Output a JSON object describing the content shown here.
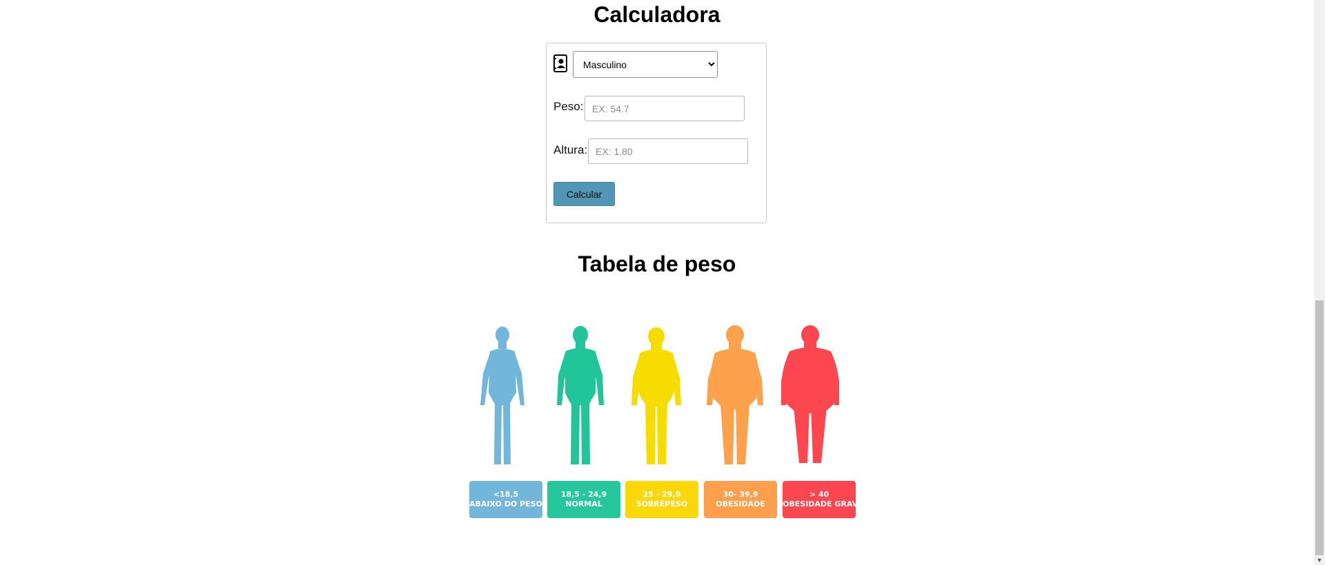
{
  "calculator": {
    "title": "Calculadora",
    "gender": {
      "selected": "Masculino",
      "options": [
        "Masculino"
      ]
    },
    "peso": {
      "label": "Peso:",
      "placeholder": "EX: 54.7",
      "value": ""
    },
    "altura": {
      "label": "Altura:",
      "placeholder": "EX: 1.80",
      "value": ""
    },
    "button_label": "Calcular"
  },
  "table": {
    "title": "Tabela de peso",
    "categories": [
      {
        "range": "<18,5",
        "label": "ABAIXO DO PESO",
        "color": "#73b6db",
        "badge_color": "#73b6db"
      },
      {
        "range": "18,5 - 24,9",
        "label": "NORMAL",
        "color": "#21c599",
        "badge_color": "#27c79e"
      },
      {
        "range": "25 - 29,9",
        "label": "SOBREPESO",
        "color": "#f7dc00",
        "badge_color": "#fcd80b"
      },
      {
        "range": "30- 39,9",
        "label": "OBESIDADE",
        "color": "#fea14c",
        "badge_color": "#fe9f4d"
      },
      {
        "range": "> 40",
        "label": "OBESIDADE GRAVE",
        "color": "#fc4650",
        "badge_color": "#fc4650"
      }
    ]
  },
  "colors": {
    "button": "#5296b5"
  }
}
